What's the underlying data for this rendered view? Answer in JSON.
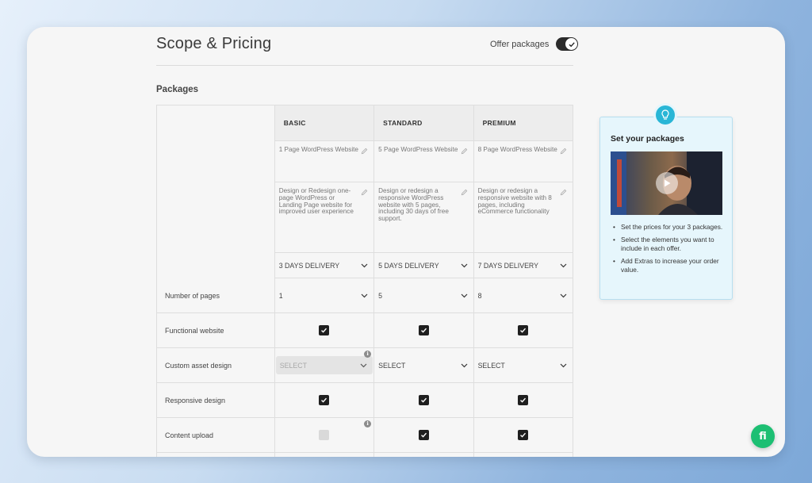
{
  "header": {
    "title": "Scope & Pricing",
    "offer_packages_label": "Offer packages",
    "offer_packages_on": true
  },
  "section_title": "Packages",
  "packages": [
    {
      "name": "BASIC",
      "title": "1 Page WordPress Website",
      "description": "Design or Redesign one-page WordPress or Landing Page website for improved user experience",
      "delivery": "3 DAYS DELIVERY",
      "pages": "1",
      "functional_website": true,
      "custom_asset_design": "SELECT",
      "responsive_design": true,
      "content_upload": false
    },
    {
      "name": "STANDARD",
      "title": "5 Page WordPress Website",
      "description": "Design or redesign a responsive WordPress website with 5 pages, including 30 days of free support.",
      "delivery": "5 DAYS DELIVERY",
      "pages": "5",
      "functional_website": true,
      "custom_asset_design": "SELECT",
      "responsive_design": true,
      "content_upload": true
    },
    {
      "name": "PREMIUM",
      "title": "8 Page WordPress Website",
      "description": "Design or redesign a responsive website with 8 pages, including eCommerce functionality",
      "delivery": "7 DAYS DELIVERY",
      "pages": "8",
      "functional_website": true,
      "custom_asset_design": "SELECT",
      "responsive_design": true,
      "content_upload": true
    }
  ],
  "row_labels": {
    "pages": "Number of pages",
    "functional_website": "Functional website",
    "custom_asset_design": "Custom asset design",
    "responsive_design": "Responsive design",
    "content_upload": "Content upload"
  },
  "tip": {
    "title": "Set your packages",
    "bullets": [
      "Set the prices for your 3 packages.",
      "Select the elements you want to include in each offer.",
      "Add Extras to increase your order value."
    ]
  },
  "fab_label": "fi",
  "colors": {
    "accent_blue": "#29b6d6",
    "brand_green": "#1dbf73",
    "checkbox": "#1f1f1f"
  }
}
